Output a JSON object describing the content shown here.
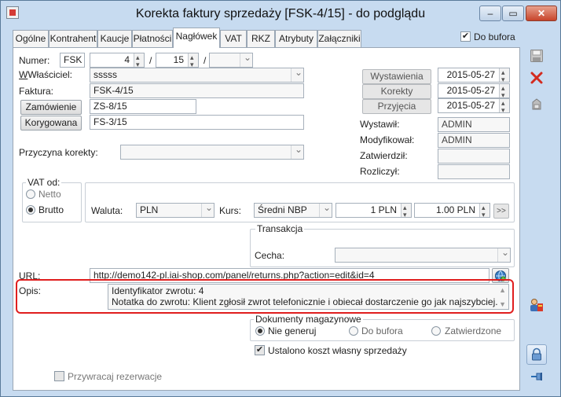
{
  "window": {
    "title": "Korekta faktury sprzedaży [FSK-4/15]  - do podglądu",
    "min_label": "–",
    "max_label": "▭",
    "close_label": "✕"
  },
  "tabs": [
    "Ogólne",
    "Kontrahent",
    "Kaucje",
    "Płatności",
    "Nagłówek",
    "VAT",
    "RKZ",
    "Atrybuty",
    "Załączniki"
  ],
  "do_bufora": {
    "label": "Do bufora",
    "checked": true
  },
  "form": {
    "numer_label": "Numer:",
    "numer_prefix": "FSK",
    "numer_value": "4",
    "numer_month": "15",
    "numer_sep": "/",
    "wlasciciel_label": "Właściciel:",
    "wlasciciel_value": "sssss",
    "faktura_label": "Faktura:",
    "faktura_value": "FSK-4/15",
    "zamowienie_button": "Zamówienie",
    "zamowienie_value": "ZS-8/15",
    "korygowana_button": "Korygowana",
    "korygowana_value": "FS-3/15",
    "przyczyna_label": "Przyczyna korekty:",
    "przyczyna_value": ""
  },
  "dates": {
    "wystawienia_label": "Wystawienia",
    "wystawienia_value": "2015-05-27",
    "korekty_label": "Korekty",
    "korekty_value": "2015-05-27",
    "przyjecia_label": "Przyjęcia",
    "przyjecia_value": "2015-05-27"
  },
  "users": {
    "wystawil_label": "Wystawił:",
    "wystawil_value": "ADMIN",
    "modyfikowal_label": "Modyfikował:",
    "modyfikowal_value": "ADMIN",
    "zatwierdzil_label": "Zatwierdził:",
    "zatwierdzil_value": "",
    "rozliczyl_label": "Rozliczył:",
    "rozliczyl_value": ""
  },
  "vat": {
    "group_label": "VAT od:",
    "netto_label": "Netto",
    "brutto_label": "Brutto",
    "selected": "Brutto"
  },
  "currency": {
    "waluta_label": "Waluta:",
    "waluta_value": "PLN",
    "kurs_label": "Kurs:",
    "kurs_value": "Średni NBP",
    "rate_left": "1 PLN",
    "rate_right": "1.00 PLN",
    "more_button": ">>"
  },
  "transakcja": {
    "group_label": "Transakcja",
    "cecha_label": "Cecha:",
    "cecha_value": ""
  },
  "url": {
    "label": "URL:",
    "value": "http://demo142-pl.iai-shop.com/panel/returns.php?action=edit&id=4"
  },
  "opis": {
    "label": "Opis:",
    "line1": "Identyfikator zwrotu: 4",
    "line2": "Notatka do zwrotu: Klient zgłosił zwrot telefonicznie i obiecał dostarczenie go jak najszybciej."
  },
  "dokumenty": {
    "group_label": "Dokumenty magazynowe",
    "opt1": "Nie generuj",
    "opt2": "Do bufora",
    "opt3": "Zatwierdzone",
    "selected": "Nie generuj"
  },
  "koszt": {
    "label": "Ustalono koszt własny sprzedaży",
    "checked": true
  },
  "rezerwacje": {
    "label": "Przywracaj rezerwacje",
    "checked": false
  },
  "colors": {
    "highlight": "#e01e1e",
    "frame": "#c7dbf0",
    "accent_blue": "#2a6db3"
  },
  "icons": [
    "save-icon",
    "cancel-icon",
    "print-icon",
    "contractor-icon",
    "lock-icon",
    "pin-icon",
    "globe-icon",
    "help-icon"
  ]
}
